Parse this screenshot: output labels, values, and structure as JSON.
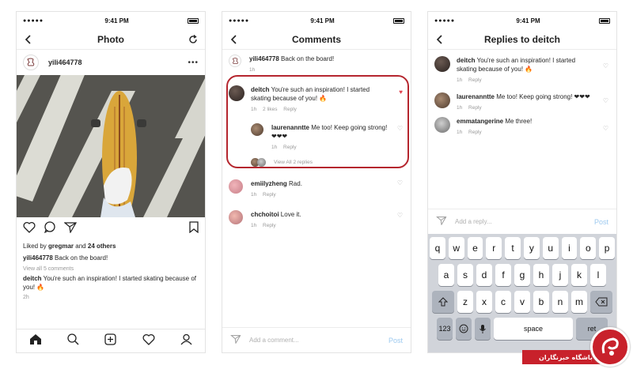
{
  "status": {
    "time": "9:41 PM"
  },
  "photo_screen": {
    "title": "Photo",
    "username": "yili464778",
    "likes_prefix": "Liked by",
    "likes_user": "gregmar",
    "likes_and": "and",
    "likes_count": "24 others",
    "caption_user": "yili464778",
    "caption_text": "Back on the board!",
    "view_all": "View all 5 comments",
    "comment_user": "deitch",
    "comment_text": "You're such an inspiration! I started skating because of you! 🔥",
    "age": "2h"
  },
  "comments_screen": {
    "title": "Comments",
    "caption": {
      "user": "yili464778",
      "text": "Back on the board!",
      "time": "1h"
    },
    "comments": [
      {
        "user": "deitch",
        "text": "You're such an inspiration! I started skating because of you! 🔥",
        "time": "1h",
        "likes": "2 likes",
        "reply": "Reply"
      },
      {
        "user": "laurenanntte",
        "text": "Me too! Keep going strong! ❤❤❤",
        "time": "1h",
        "reply": "Reply"
      },
      {
        "user": "emiilyzheng",
        "text": "Rad.",
        "time": "1h",
        "reply": "Reply"
      },
      {
        "user": "chchoitoi",
        "text": "Love it.",
        "time": "1h",
        "reply": "Reply"
      }
    ],
    "view_replies": "View All 2 replies",
    "add_placeholder": "Add a comment...",
    "post": "Post"
  },
  "replies_screen": {
    "title": "Replies to deitch",
    "replies": [
      {
        "user": "deitch",
        "text": "You're such an inspiration! I started skating because of you! 🔥",
        "time": "1h",
        "reply": "Reply"
      },
      {
        "user": "laurenanntte",
        "text": "Me too! Keep going strong! ❤❤❤",
        "time": "1h",
        "reply": "Reply"
      },
      {
        "user": "emmatangerine",
        "text": "Me three!",
        "time": "1h",
        "reply": "Reply"
      }
    ],
    "add_placeholder": "Add a reply...",
    "post": "Post"
  },
  "keyboard": {
    "row1": [
      "q",
      "w",
      "e",
      "r",
      "t",
      "y",
      "u",
      "i",
      "o",
      "p"
    ],
    "row2": [
      "a",
      "s",
      "d",
      "f",
      "g",
      "h",
      "j",
      "k",
      "l"
    ],
    "row3": [
      "z",
      "x",
      "c",
      "v",
      "b",
      "n",
      "m"
    ],
    "num": "123",
    "space": "space",
    "ret": "ret"
  },
  "watermark": "باشگاه خبرنگاران",
  "colors": {
    "highlight": "#b5262e",
    "heart": "#e0424e",
    "post_link": "#9cc9ef"
  }
}
